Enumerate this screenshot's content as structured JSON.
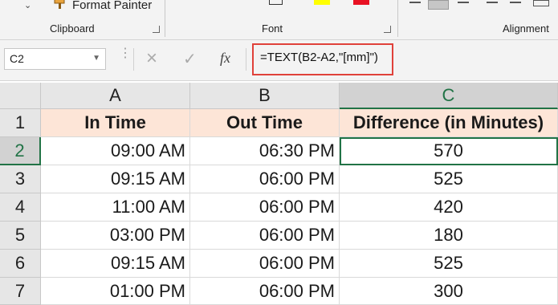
{
  "ribbon": {
    "format_painter_label": "Format Painter",
    "groups": {
      "clipboard": "Clipboard",
      "font": "Font",
      "alignment": "Alignment"
    },
    "font_color": "#e81123",
    "highlight_color": "#ffff00"
  },
  "formula_bar": {
    "name_box": "C2",
    "cancel_icon": "×",
    "enter_icon": "✓",
    "fx_label": "fx",
    "formula": "=TEXT(B2-A2,\"[mm]\")"
  },
  "sheet": {
    "columns": [
      "A",
      "B",
      "C"
    ],
    "row_numbers": [
      "1",
      "2",
      "3",
      "4",
      "5",
      "6",
      "7"
    ],
    "headers": [
      "In Time",
      "Out Time",
      "Difference (in Minutes)"
    ],
    "rows": [
      [
        "09:00 AM",
        "06:30 PM",
        "570"
      ],
      [
        "09:15 AM",
        "06:00 PM",
        "525"
      ],
      [
        "11:00 AM",
        "06:00 PM",
        "420"
      ],
      [
        "03:00 PM",
        "06:00 PM",
        "180"
      ],
      [
        "09:15 AM",
        "06:00 PM",
        "525"
      ],
      [
        "01:00 PM",
        "06:00 PM",
        "300"
      ]
    ]
  }
}
